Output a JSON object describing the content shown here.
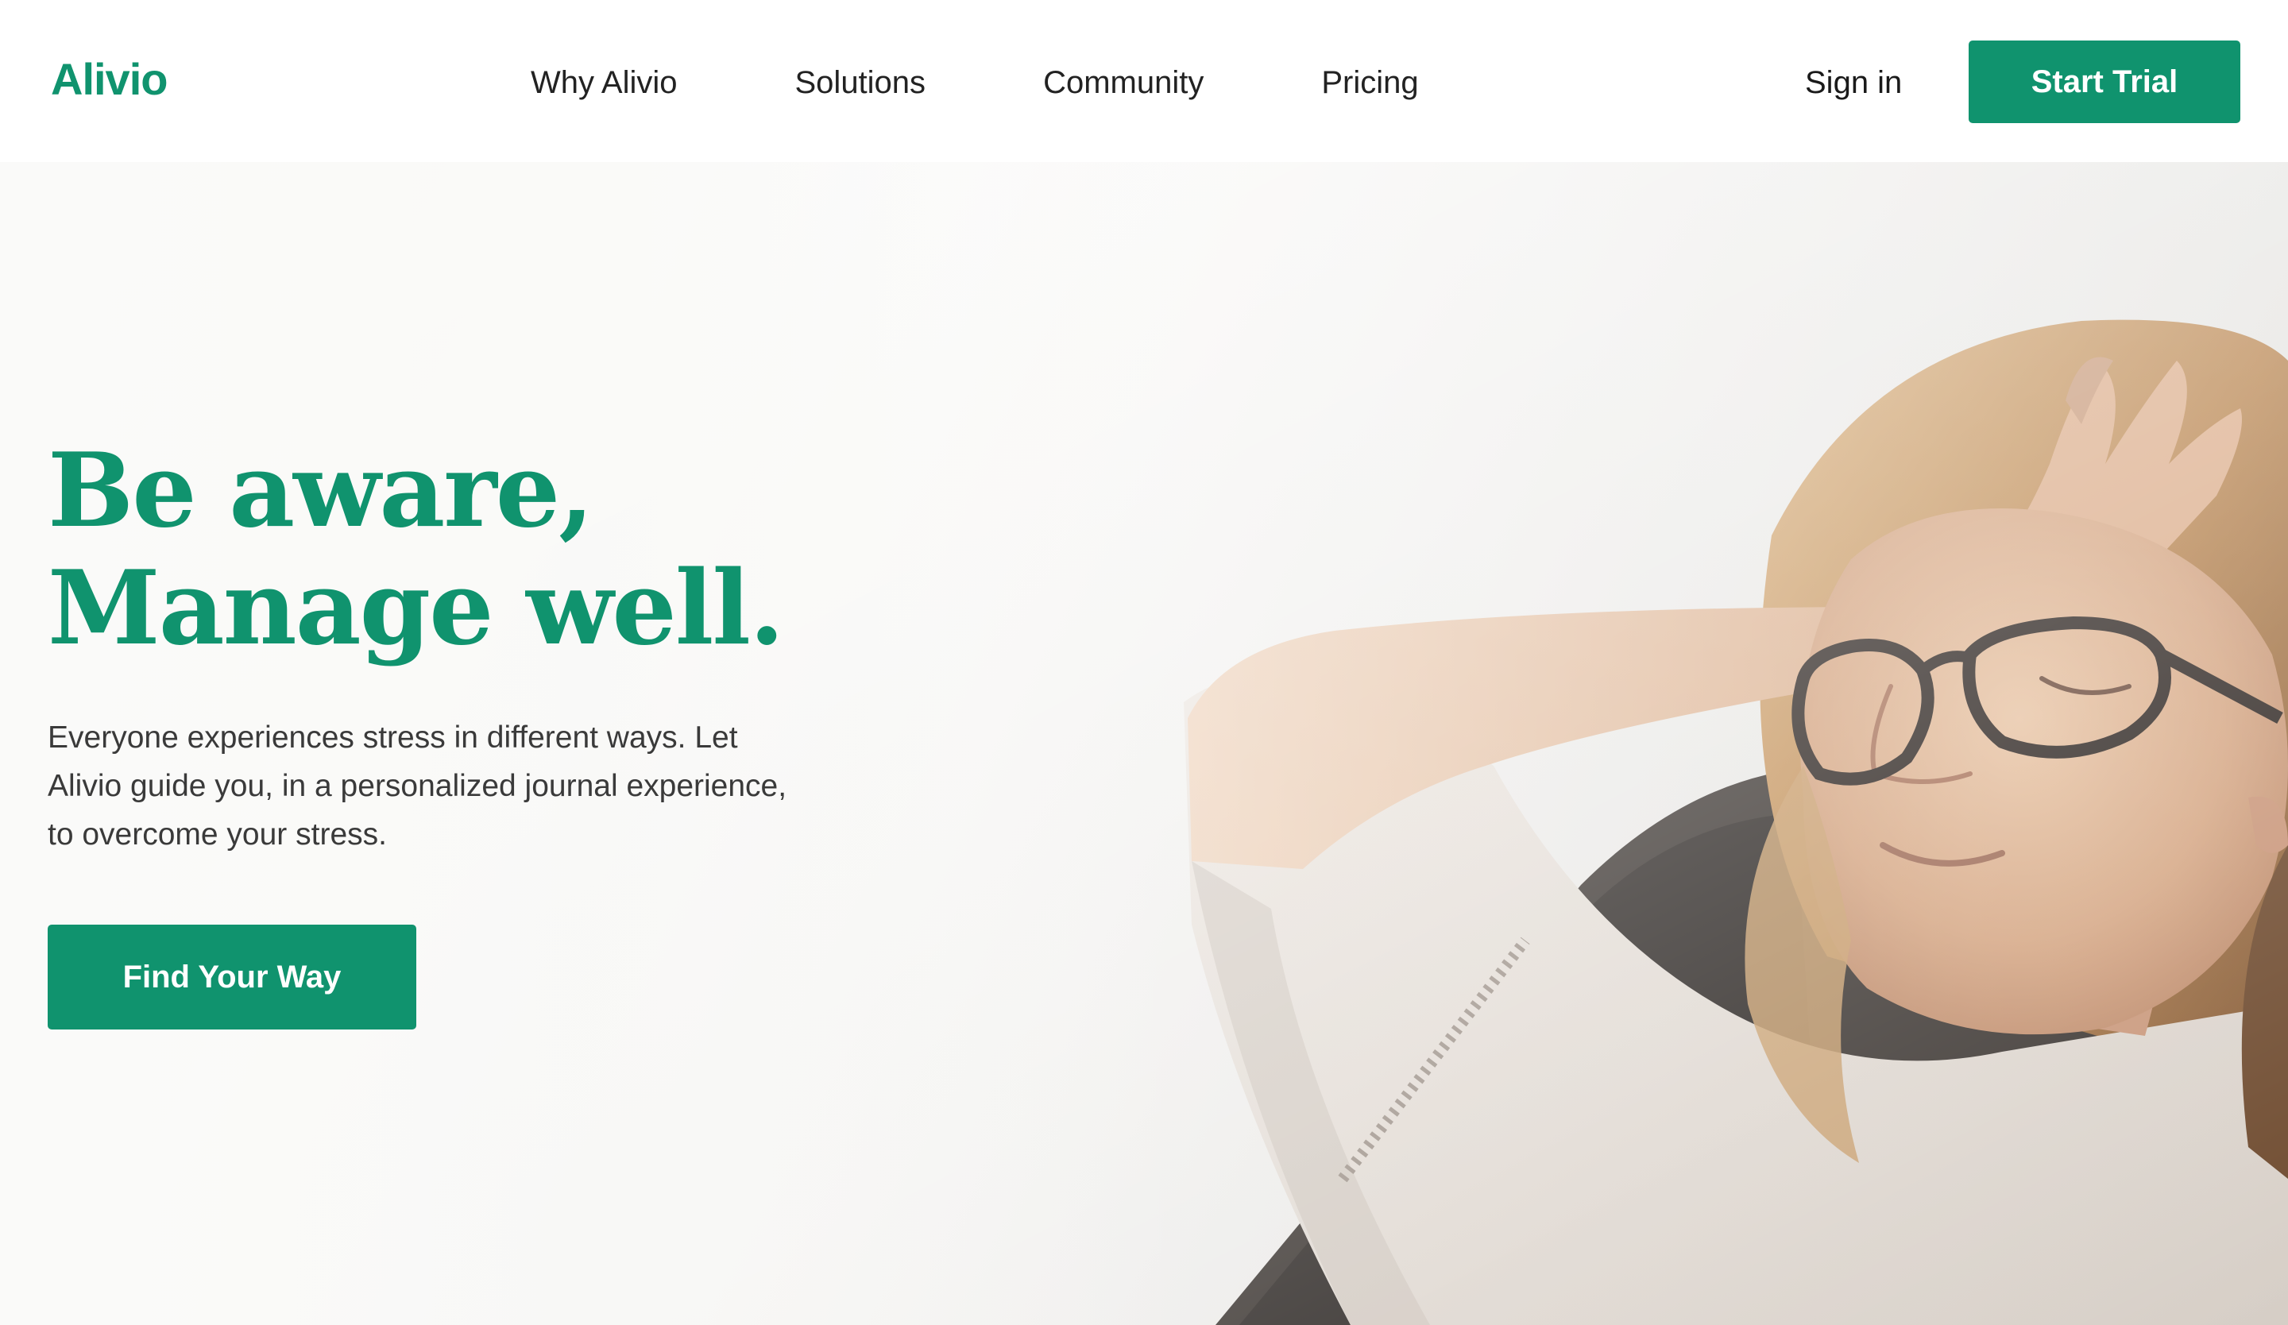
{
  "header": {
    "logo": "Alivio",
    "nav": [
      "Why Alivio",
      "Solutions",
      "Community",
      "Pricing"
    ],
    "sign_in": "Sign in",
    "start_trial": "Start Trial"
  },
  "hero": {
    "headline_line1": "Be aware,",
    "headline_line2": "Manage well.",
    "lede": "Everyone experiences stress in different ways. Let Alivio guide you, in a personalized journal experience, to overcome your stress.",
    "cta": "Find Your Way",
    "photo_name": "woman-relaxing-photo"
  },
  "colors": {
    "brand_green": "#10936e",
    "text_dark": "#222222",
    "text_body": "#3a3a3a"
  }
}
